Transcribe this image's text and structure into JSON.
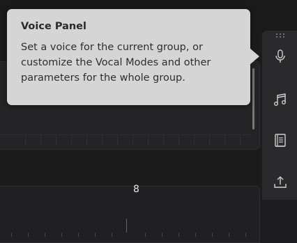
{
  "tooltip": {
    "title": "Voice Panel",
    "body": "Set a voice for the current group, or customize the Vocal Modes and other parameters for the whole group."
  },
  "timeline": {
    "measure_label": "8"
  },
  "sidebar": {
    "items": [
      {
        "icon": "microphone-icon",
        "label": "Voice Panel"
      },
      {
        "icon": "music-note-icon"
      },
      {
        "icon": "book-icon"
      },
      {
        "icon": "upload-icon"
      }
    ]
  },
  "colors": {
    "background": "#1d1d1f",
    "tooltip_bg": "#d5d5d5",
    "icon": "#cfcfcf"
  }
}
